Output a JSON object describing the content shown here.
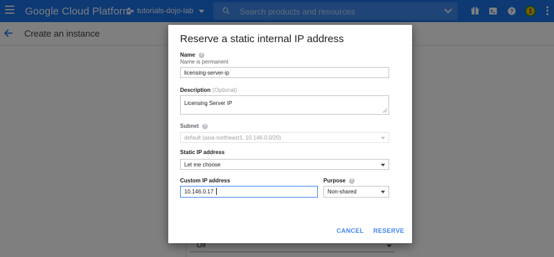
{
  "topbar": {
    "brand": "Google Cloud Platform",
    "project": "tutorials-dojo-lab",
    "search_placeholder": "Search products and resources",
    "avatar_initial": "1",
    "colors": {
      "bar": "#1a73e8",
      "search": "#3f88ec",
      "avatar": "#fbbc04"
    },
    "icons": [
      "menu-icon",
      "project-icon",
      "search-icon",
      "expand-icon",
      "gift-icon",
      "cloud-shell-icon",
      "help-icon",
      "more-vert-icon"
    ]
  },
  "page": {
    "title": "Create an instance",
    "background_select_value": "Off"
  },
  "dialog": {
    "title": "Reserve a static internal IP address",
    "name": {
      "label": "Name",
      "sublabel": "Name is permanent",
      "value": "licensing-server-ip"
    },
    "description": {
      "label": "Description",
      "optional_tag": "(Optional)",
      "value": "Licensing Server IP"
    },
    "subnet": {
      "label": "Subnet",
      "value": "default (asia-northeast1, 10.146.0.0/20)",
      "disabled": true
    },
    "static_ip": {
      "label": "Static IP address",
      "value": "Let me choose"
    },
    "custom_ip": {
      "label": "Custom IP address",
      "value": "10.146.0.17"
    },
    "purpose": {
      "label": "Purpose",
      "value": "Non-shared"
    },
    "buttons": {
      "cancel": "CANCEL",
      "reserve": "RESERVE"
    },
    "accent_color": "#4285f4"
  }
}
